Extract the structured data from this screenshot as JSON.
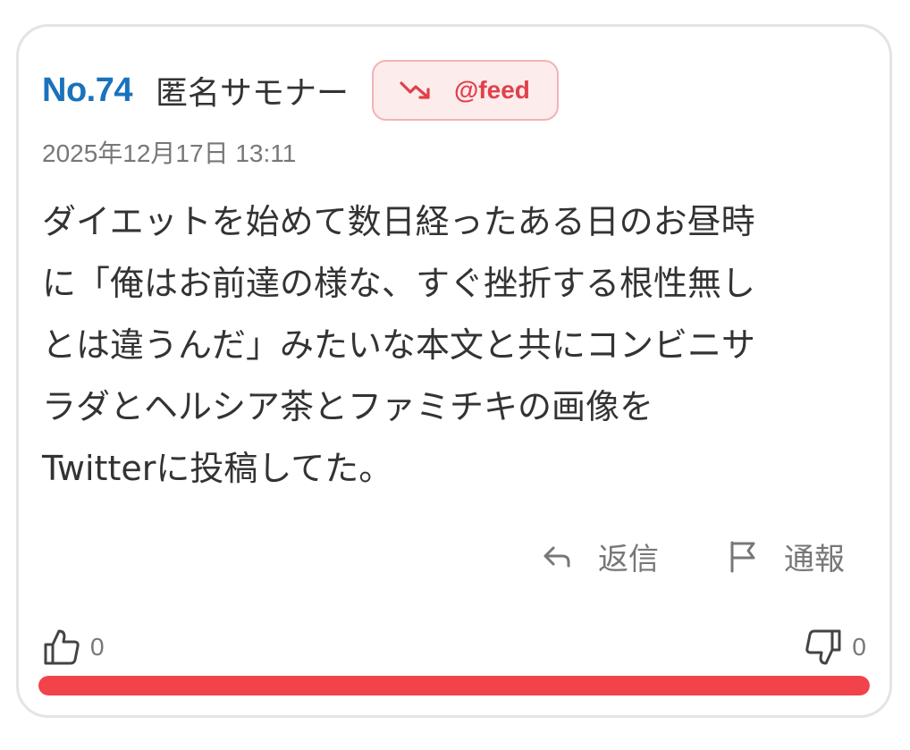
{
  "post": {
    "number": "No.74",
    "poster": "匿名サモナー",
    "feed_badge": {
      "icon": "trending-down-icon",
      "label": "@feed"
    },
    "timestamp": "2025年12月17日 13:11",
    "body": "ダイエットを始めて数日経ったある日のお昼時\nに「俺はお前達の様な、すぐ挫折する根性無し\nとは違うんだ」みたいな本文と共にコンビニサ\nラダとヘルシア茶とファミチキの画像を\nTwitterに投稿してた。"
  },
  "actions": {
    "reply": {
      "icon": "reply-arrow-icon",
      "label": "返信"
    },
    "report": {
      "icon": "flag-icon",
      "label": "通報"
    }
  },
  "votes": {
    "up": {
      "icon": "thumbs-up-icon",
      "count": "0"
    },
    "down": {
      "icon": "thumbs-down-icon",
      "count": "0"
    },
    "bar_fill_fraction": 1.0,
    "bar_color": "#f2424a"
  },
  "colors": {
    "post_number": "#1a72bd",
    "badge_text": "#e0414a",
    "badge_bg": "#fdecec",
    "badge_border": "#f1b3b6"
  }
}
